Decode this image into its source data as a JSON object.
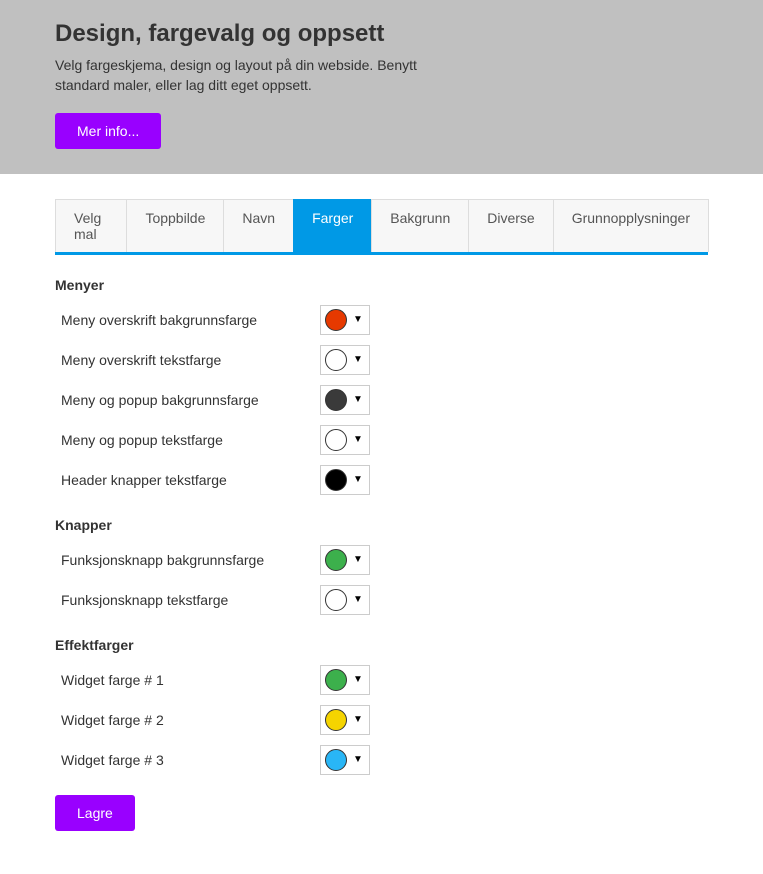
{
  "header": {
    "title": "Design, fargevalg og oppsett",
    "description": "Velg fargeskjema, design og layout på din webside. Benytt standard maler, eller lag ditt eget oppsett.",
    "more_info_label": "Mer info..."
  },
  "tabs": [
    {
      "label": "Velg mal",
      "active": false
    },
    {
      "label": "Toppbilde",
      "active": false
    },
    {
      "label": "Navn",
      "active": false
    },
    {
      "label": "Farger",
      "active": true
    },
    {
      "label": "Bakgrunn",
      "active": false
    },
    {
      "label": "Diverse",
      "active": false
    },
    {
      "label": "Grunnopplysninger",
      "active": false
    }
  ],
  "sections": {
    "menyer": {
      "title": "Menyer",
      "items": [
        {
          "label": "Meny overskrift bakgrunnsfarge",
          "color": "#e63900"
        },
        {
          "label": "Meny overskrift tekstfarge",
          "color": "#ffffff"
        },
        {
          "label": "Meny og popup bakgrunnsfarge",
          "color": "#3a3a3a"
        },
        {
          "label": "Meny og popup tekstfarge",
          "color": "#ffffff"
        },
        {
          "label": "Header knapper tekstfarge",
          "color": "#000000"
        }
      ]
    },
    "knapper": {
      "title": "Knapper",
      "items": [
        {
          "label": "Funksjonsknapp bakgrunnsfarge",
          "color": "#3cb04c"
        },
        {
          "label": "Funksjonsknapp tekstfarge",
          "color": "#ffffff"
        }
      ]
    },
    "effektfarger": {
      "title": "Effektfarger",
      "items": [
        {
          "label": "Widget farge # 1",
          "color": "#3cb04c"
        },
        {
          "label": "Widget farge # 2",
          "color": "#f5d400"
        },
        {
          "label": "Widget farge # 3",
          "color": "#29b6f6"
        }
      ]
    }
  },
  "save_label": "Lagre"
}
